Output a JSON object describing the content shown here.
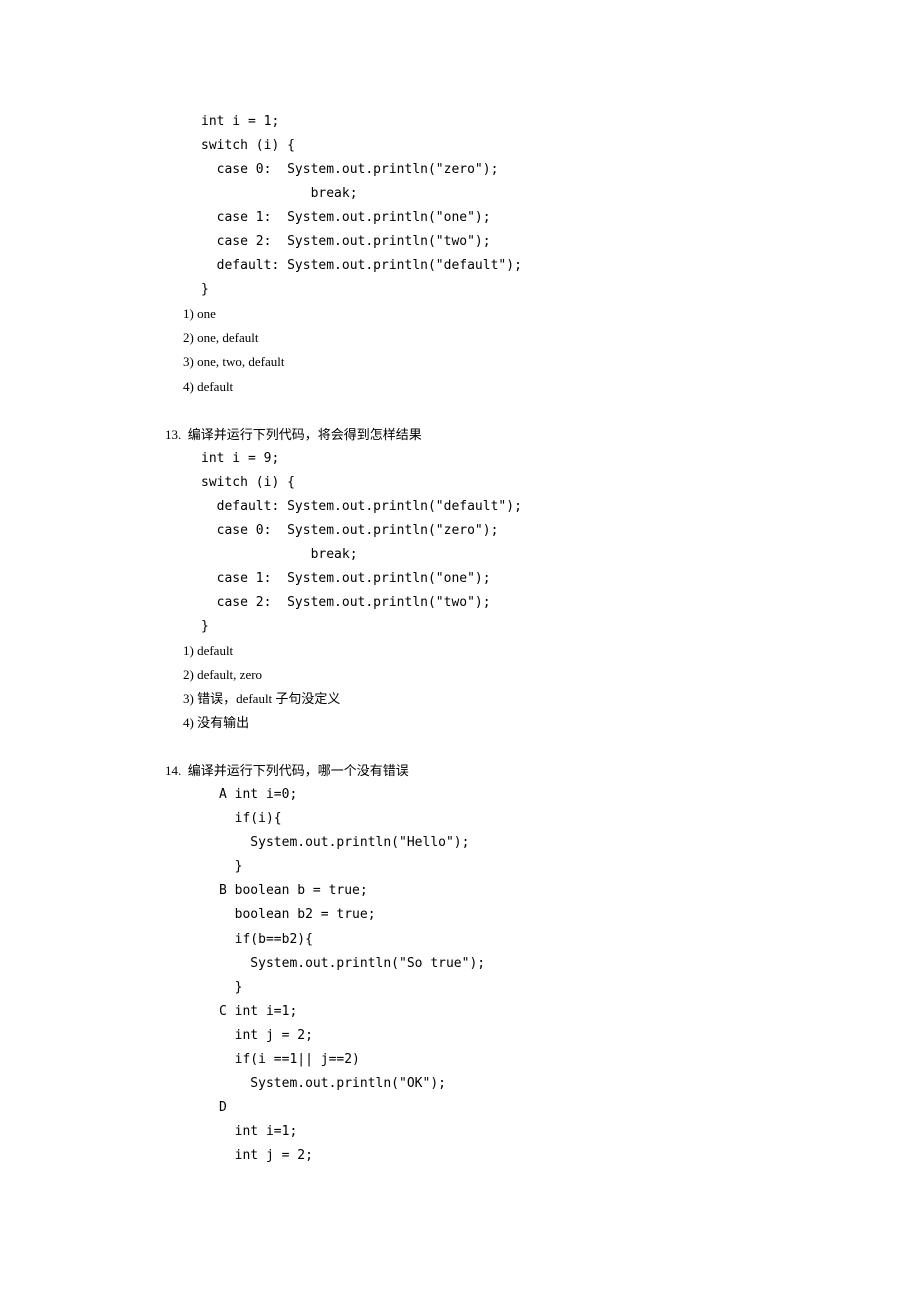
{
  "q12": {
    "code": [
      "int i = 1;",
      "switch (i) {",
      "  case 0:  System.out.println(\"zero\");",
      "              break;",
      "  case 1:  System.out.println(\"one\");",
      "  case 2:  System.out.println(\"two\");",
      "  default: System.out.println(\"default\");",
      "}"
    ],
    "opts": [
      "1) one",
      "2) one, default",
      "3) one, two, default",
      "4) default"
    ]
  },
  "q13": {
    "header": "13.  编译并运行下列代码，将会得到怎样结果",
    "code": [
      "int i = 9;",
      "switch (i) {",
      "  default: System.out.println(\"default\");",
      "  case 0:  System.out.println(\"zero\");",
      "              break;",
      "  case 1:  System.out.println(\"one\");",
      "  case 2:  System.out.println(\"two\");",
      "}"
    ],
    "opts": [
      "1) default",
      "2) default, zero",
      "3) 错误，default 子句没定义",
      "4) 没有输出"
    ]
  },
  "q14": {
    "header": "14.  编译并运行下列代码，哪一个没有错误",
    "items": [
      "A int i=0;",
      "  if(i){",
      "    System.out.println(\"Hello\");",
      "  }",
      "B boolean b = true;",
      "  boolean b2 = true;",
      "  if(b==b2){",
      "    System.out.println(\"So true\");",
      "  }",
      "C int i=1;",
      "  int j = 2;",
      "  if(i ==1|| j==2)",
      "    System.out.println(\"OK\");",
      "D",
      "  int i=1;",
      "  int j = 2;"
    ]
  }
}
